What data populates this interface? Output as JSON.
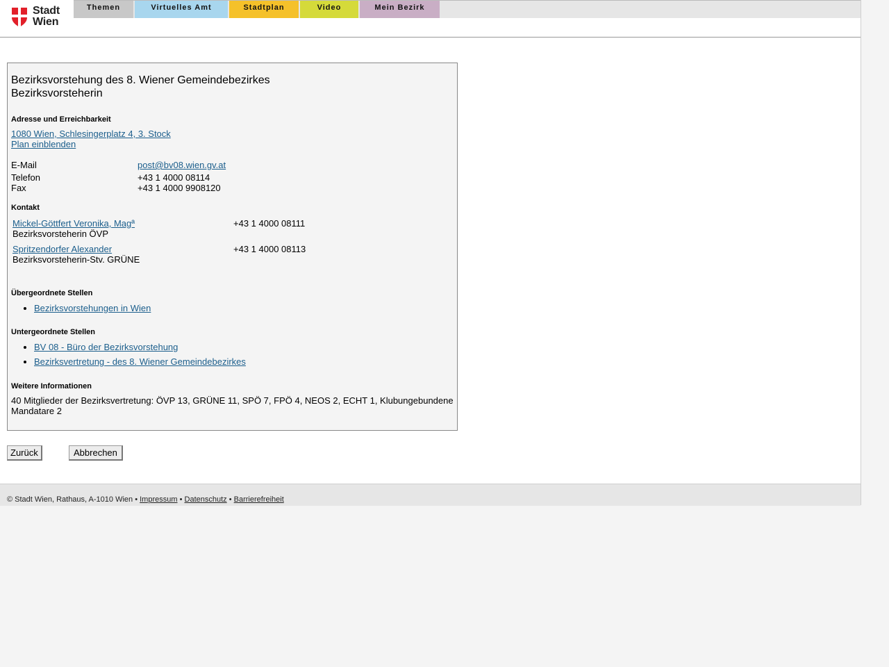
{
  "logo": {
    "line1": "Stadt",
    "line2": "Wien"
  },
  "nav": [
    {
      "label": "Themen",
      "color": "#c8c8c8"
    },
    {
      "label": "Virtuelles Amt",
      "color": "#a8d6ee"
    },
    {
      "label": "Stadtplan",
      "color": "#f5c12a"
    },
    {
      "label": "Video",
      "color": "#d5da3a"
    },
    {
      "label": "Mein Bezirk",
      "color": "#c9aec5"
    }
  ],
  "card": {
    "title_line1": "Bezirksvorstehung des 8. Wiener Gemeindebezirkes",
    "title_line2": "Bezirksvorsteherin",
    "address_heading": "Adresse und Erreichbarkeit",
    "address_link": "1080 Wien, Schlesingerplatz 4, 3. Stock",
    "map_link": "Plan einblenden",
    "email_label": "E-Mail",
    "email_value": "post@bv08.wien.gv.at",
    "phone_label": "Telefon",
    "phone_value": "+43 1 4000 08114",
    "fax_label": "Fax",
    "fax_value": "+43 1 4000 9908120",
    "contact_heading": "Kontakt",
    "contacts": [
      {
        "name": "Mickel-Göttfert Veronika, Magª",
        "role": "Bezirksvorsteherin ÖVP",
        "phone": "+43 1 4000 08111"
      },
      {
        "name": "Spritzendorfer Alexander",
        "role": "Bezirksvorsteherin-Stv. GRÜNE",
        "phone": "+43 1 4000 08113"
      }
    ],
    "superior_heading": "Übergeordnete Stellen",
    "superior": [
      "Bezirksvorstehungen in Wien"
    ],
    "subordinate_heading": "Untergeordnete Stellen",
    "subordinate": [
      "BV 08 - Büro der Bezirksvorstehung",
      "Bezirksvertretung - des 8. Wiener Gemeindebezirkes"
    ],
    "info_heading": "Weitere Informationen",
    "info_text": "40 Mitglieder der Bezirksvertretung: ÖVP 13, GRÜNE 11, SPÖ 7, FPÖ 4, NEOS 2, ECHT 1, Klubungebundene Mandatare 2"
  },
  "buttons": {
    "back": "Zurück",
    "cancel": "Abbrechen"
  },
  "footer": {
    "copyright": "© Stadt Wien, Rathaus, A-1010 Wien",
    "sep": "•",
    "impressum": "Impressum",
    "datenschutz": "Datenschutz",
    "barrierefreiheit": "Barrierefreiheit"
  }
}
